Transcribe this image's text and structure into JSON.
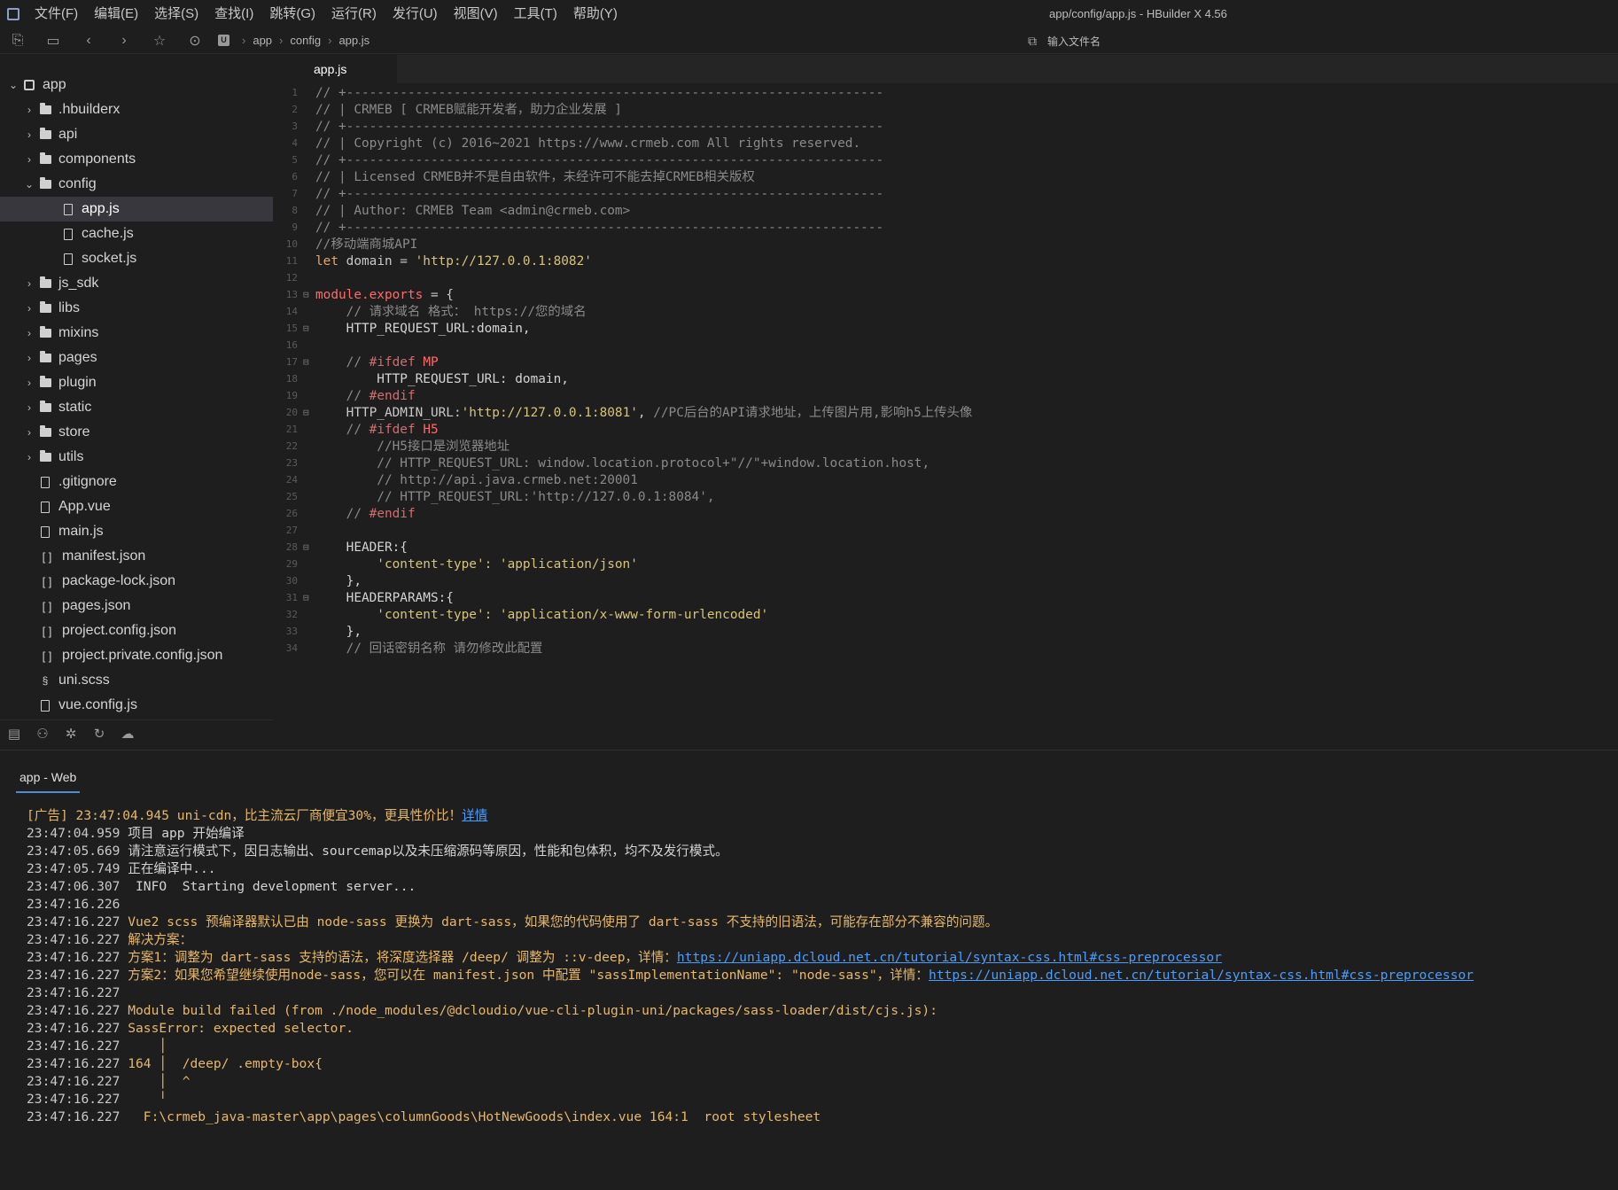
{
  "app": {
    "window_title": "app/config/app.js - HBuilder X 4.56"
  },
  "menu": [
    "文件(F)",
    "编辑(E)",
    "选择(S)",
    "查找(I)",
    "跳转(G)",
    "运行(R)",
    "发行(U)",
    "视图(V)",
    "工具(T)",
    "帮助(Y)"
  ],
  "toolbar": {
    "breadcrumb": [
      "app",
      "config",
      "app.js"
    ],
    "file_search_placeholder": "输入文件名"
  },
  "sidebar": {
    "items": [
      {
        "label": "app",
        "kind": "project",
        "expanded": true,
        "depth": 0
      },
      {
        "label": ".hbuilderx",
        "kind": "folder",
        "depth": 1
      },
      {
        "label": "api",
        "kind": "folder",
        "depth": 1
      },
      {
        "label": "components",
        "kind": "folder",
        "depth": 1
      },
      {
        "label": "config",
        "kind": "folder-open",
        "expanded": true,
        "depth": 1
      },
      {
        "label": "app.js",
        "kind": "file",
        "depth": 2,
        "selected": true
      },
      {
        "label": "cache.js",
        "kind": "file",
        "depth": 2
      },
      {
        "label": "socket.js",
        "kind": "file",
        "depth": 2
      },
      {
        "label": "js_sdk",
        "kind": "folder",
        "depth": 1
      },
      {
        "label": "libs",
        "kind": "folder",
        "depth": 1
      },
      {
        "label": "mixins",
        "kind": "folder",
        "depth": 1
      },
      {
        "label": "pages",
        "kind": "folder",
        "depth": 1
      },
      {
        "label": "plugin",
        "kind": "folder",
        "depth": 1
      },
      {
        "label": "static",
        "kind": "folder",
        "depth": 1
      },
      {
        "label": "store",
        "kind": "folder",
        "depth": 1
      },
      {
        "label": "utils",
        "kind": "folder",
        "depth": 1
      },
      {
        "label": ".gitignore",
        "kind": "file",
        "depth": 1
      },
      {
        "label": "App.vue",
        "kind": "file",
        "depth": 1
      },
      {
        "label": "main.js",
        "kind": "file",
        "depth": 1
      },
      {
        "label": "manifest.json",
        "kind": "json",
        "depth": 1
      },
      {
        "label": "package-lock.json",
        "kind": "json",
        "depth": 1
      },
      {
        "label": "pages.json",
        "kind": "json",
        "depth": 1
      },
      {
        "label": "project.config.json",
        "kind": "json",
        "depth": 1
      },
      {
        "label": "project.private.config.json",
        "kind": "json",
        "depth": 1
      },
      {
        "label": "uni.scss",
        "kind": "scss",
        "depth": 1
      },
      {
        "label": "vue.config.js",
        "kind": "file",
        "depth": 1
      }
    ]
  },
  "editor": {
    "tab": "app.js",
    "lines": [
      {
        "n": "1",
        "text": "// +----------------------------------------------------------------------",
        "cls": "c-comment"
      },
      {
        "n": "2",
        "text": "// | CRMEB [ CRMEB赋能开发者，助力企业发展 ]",
        "cls": "c-comment"
      },
      {
        "n": "3",
        "text": "// +----------------------------------------------------------------------",
        "cls": "c-comment"
      },
      {
        "n": "4",
        "text": "// | Copyright (c) 2016~2021 https://www.crmeb.com All rights reserved.",
        "cls": "c-comment"
      },
      {
        "n": "5",
        "text": "// +----------------------------------------------------------------------",
        "cls": "c-comment"
      },
      {
        "n": "6",
        "text": "// | Licensed CRMEB并不是自由软件，未经许可不能去掉CRMEB相关版权",
        "cls": "c-comment"
      },
      {
        "n": "7",
        "text": "// +----------------------------------------------------------------------",
        "cls": "c-comment"
      },
      {
        "n": "8",
        "text": "// | Author: CRMEB Team <admin@crmeb.com>",
        "cls": "c-comment"
      },
      {
        "n": "9",
        "text": "// +----------------------------------------------------------------------",
        "cls": "c-comment"
      },
      {
        "n": "10",
        "text": "//移动端商城API",
        "cls": "c-comment"
      },
      {
        "n": "11",
        "text": "let domain = 'http://127.0.0.1:8082'",
        "cls": "mixed-domain"
      },
      {
        "n": "12",
        "text": "",
        "cls": ""
      },
      {
        "n": "13",
        "text": "module.exports = {",
        "cls": "mixed-module",
        "fold": "⊟"
      },
      {
        "n": "14",
        "text": "    // 请求域名 格式： https://您的域名",
        "cls": "c-comment"
      },
      {
        "n": "15",
        "text": "    HTTP_REQUEST_URL:domain,",
        "cls": "c-prop",
        "fold": "⊟"
      },
      {
        "n": "16",
        "text": "",
        "cls": ""
      },
      {
        "n": "17",
        "text": "    // #ifdef MP",
        "cls": "mixed-ifdef",
        "fold": "⊟"
      },
      {
        "n": "18",
        "text": "        HTTP_REQUEST_URL: domain,",
        "cls": "c-prop"
      },
      {
        "n": "19",
        "text": "    // #endif",
        "cls": "mixed-endif"
      },
      {
        "n": "20",
        "text": "    HTTP_ADMIN_URL:'http://127.0.0.1:8081', //PC后台的API请求地址，上传图片用,影响h5上传头像",
        "cls": "mixed-admin",
        "fold": "⊟"
      },
      {
        "n": "21",
        "text": "    // #ifdef H5",
        "cls": "mixed-ifdef"
      },
      {
        "n": "22",
        "text": "        //H5接口是浏览器地址",
        "cls": "c-comment"
      },
      {
        "n": "23",
        "text": "        // HTTP_REQUEST_URL: window.location.protocol+\"//\"+window.location.host,",
        "cls": "c-comment"
      },
      {
        "n": "24",
        "text": "        // http://api.java.crmeb.net:20001",
        "cls": "c-comment"
      },
      {
        "n": "25",
        "text": "        // HTTP_REQUEST_URL:'http://127.0.0.1:8084',",
        "cls": "c-comment"
      },
      {
        "n": "26",
        "text": "    // #endif",
        "cls": "mixed-endif"
      },
      {
        "n": "27",
        "text": "",
        "cls": ""
      },
      {
        "n": "28",
        "text": "    HEADER:{",
        "cls": "c-prop",
        "fold": "⊟"
      },
      {
        "n": "29",
        "text": "        'content-type': 'application/json'",
        "cls": "c-string"
      },
      {
        "n": "30",
        "text": "    },",
        "cls": "c-prop"
      },
      {
        "n": "31",
        "text": "    HEADERPARAMS:{",
        "cls": "c-prop",
        "fold": "⊟"
      },
      {
        "n": "32",
        "text": "        'content-type': 'application/x-www-form-urlencoded'",
        "cls": "c-string"
      },
      {
        "n": "33",
        "text": "    },",
        "cls": "c-prop"
      },
      {
        "n": "34",
        "text": "    // 回话密钥名称 请勿修改此配置",
        "cls": "c-comment"
      }
    ]
  },
  "console": {
    "tab": "app - Web",
    "lines": [
      {
        "ts": "[广告] 23:47:04.945",
        "msg": "uni-cdn，比主流云厂商便宜30%，更具性价比！",
        "link": "详情",
        "kind": "ad"
      },
      {
        "ts": "23:47:04.959",
        "msg": "项目 app 开始编译",
        "kind": "info"
      },
      {
        "ts": "23:47:05.669",
        "msg": "请注意运行模式下，因日志输出、sourcemap以及未压缩源码等原因，性能和包体积，均不及发行模式。",
        "kind": "info"
      },
      {
        "ts": "23:47:05.749",
        "msg": "正在编译中...",
        "kind": "info"
      },
      {
        "ts": "23:47:06.307",
        "msg": " INFO  Starting development server...",
        "kind": "info"
      },
      {
        "ts": "23:47:16.226",
        "msg": "",
        "kind": "info"
      },
      {
        "ts": "23:47:16.227",
        "msg": "Vue2 scss 预编译器默认已由 node-sass 更换为 dart-sass，如果您的代码使用了 dart-sass 不支持的旧语法，可能存在部分不兼容的问题。",
        "kind": "warn"
      },
      {
        "ts": "23:47:16.227",
        "msg": "解决方案：",
        "kind": "warn"
      },
      {
        "ts": "23:47:16.227",
        "msg": "方案1：调整为 dart-sass 支持的语法，将深度选择器 /deep/ 调整为 ::v-deep，详情：",
        "link": "https://uniapp.dcloud.net.cn/tutorial/syntax-css.html#css-preprocessor",
        "kind": "warn"
      },
      {
        "ts": "23:47:16.227",
        "msg": "方案2：如果您希望继续使用node-sass，您可以在 manifest.json 中配置 \"sassImplementationName\": \"node-sass\"，详情：",
        "link": "https://uniapp.dcloud.net.cn/tutorial/syntax-css.html#css-preprocessor",
        "kind": "warn"
      },
      {
        "ts": "23:47:16.227",
        "msg": "",
        "kind": "info"
      },
      {
        "ts": "23:47:16.227",
        "msg": "Module build failed (from ./node_modules/@dcloudio/vue-cli-plugin-uni/packages/sass-loader/dist/cjs.js):",
        "kind": "err"
      },
      {
        "ts": "23:47:16.227",
        "msg": "SassError: expected selector.",
        "kind": "err"
      },
      {
        "ts": "23:47:16.227",
        "msg": "    │",
        "kind": "err"
      },
      {
        "ts": "23:47:16.227",
        "msg": "164 │  /deep/ .empty-box{",
        "kind": "err"
      },
      {
        "ts": "23:47:16.227",
        "msg": "    │  ^",
        "kind": "err"
      },
      {
        "ts": "23:47:16.227",
        "msg": "    ╵",
        "kind": "err"
      },
      {
        "ts": "23:47:16.227",
        "msg": "  F:\\crmeb_java-master\\app\\pages\\columnGoods\\HotNewGoods\\index.vue 164:1  root stylesheet",
        "kind": "err"
      }
    ]
  }
}
